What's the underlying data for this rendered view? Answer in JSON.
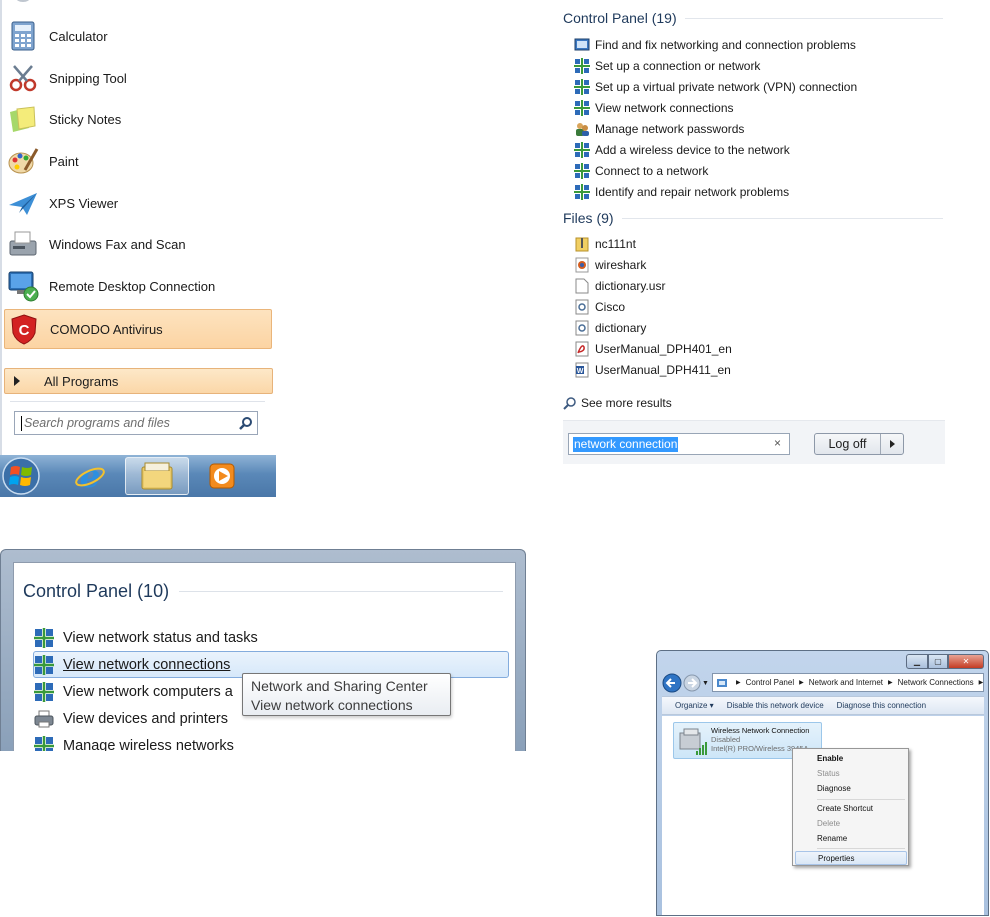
{
  "start_menu": {
    "programs": [
      {
        "label": "Calculator",
        "icon": "calculator-icon"
      },
      {
        "label": "Snipping Tool",
        "icon": "scissors-icon"
      },
      {
        "label": "Sticky Notes",
        "icon": "sticky-notes-icon"
      },
      {
        "label": "Paint",
        "icon": "paint-palette-icon"
      },
      {
        "label": "XPS Viewer",
        "icon": "paper-plane-icon"
      },
      {
        "label": "Windows Fax and Scan",
        "icon": "fax-icon"
      },
      {
        "label": "Remote Desktop Connection",
        "icon": "remote-desktop-icon"
      },
      {
        "label": "COMODO Antivirus",
        "icon": "comodo-shield-icon",
        "highlighted": true
      }
    ],
    "all_programs_label": "All Programs",
    "search_placeholder": "Search programs and files",
    "taskbar_items": [
      "start-orb-icon",
      "internet-explorer-icon",
      "explorer-folder-icon",
      "media-player-icon"
    ]
  },
  "search_results": {
    "control_panel_header": "Control Panel (19)",
    "control_panel_items": [
      "Find and fix networking and connection problems",
      "Set up a connection or network",
      "Set up a virtual private network (VPN) connection",
      "View network connections",
      "Manage network passwords",
      "Add a wireless device to the network",
      "Connect to a network",
      "Identify and repair network problems"
    ],
    "files_header": "Files (9)",
    "files": [
      {
        "label": "nc111nt",
        "icon": "zip-folder-icon"
      },
      {
        "label": "wireshark",
        "icon": "wireshark-icon"
      },
      {
        "label": "dictionary.usr",
        "icon": "blank-file-icon"
      },
      {
        "label": "Cisco",
        "icon": "settings-file-icon"
      },
      {
        "label": "dictionary",
        "icon": "settings-file-icon"
      },
      {
        "label": "UserManual_DPH401_en",
        "icon": "pdf-icon"
      },
      {
        "label": "UserManual_DPH411_en",
        "icon": "word-doc-icon"
      }
    ],
    "see_more": "See more results",
    "search_value": "network connection",
    "clear_symbol": "×",
    "log_off_label": "Log off"
  },
  "zoomed_panel": {
    "header": "Control Panel (10)",
    "items": [
      "View network status and tasks",
      "View network connections",
      "View network computers a",
      "View devices and printers",
      "Manage wireless networks"
    ],
    "tooltip_lines": [
      "Network and Sharing Center",
      "View network connections"
    ]
  },
  "network_window": {
    "breadcrumb": [
      "Control Panel",
      "Network and Internet",
      "Network Connections"
    ],
    "toolbar": [
      "Organize ▾",
      "Disable this network device",
      "Diagnose this connection"
    ],
    "connection": {
      "name": "Wireless Network Connection",
      "status": "Disabled",
      "adapter": "Intel(R) PRO/Wireless 3945A..."
    },
    "context_menu": {
      "enable": "Enable",
      "status": "Status",
      "diagnose": "Diagnose",
      "create_shortcut": "Create Shortcut",
      "delete": "Delete",
      "rename": "Rename",
      "properties": "Properties"
    }
  },
  "colors": {
    "header_blue": "#1e395b",
    "highlight_orange": "#fcd4a3",
    "selection_blue": "#3399ff",
    "taskbar": "#5a88b8"
  }
}
